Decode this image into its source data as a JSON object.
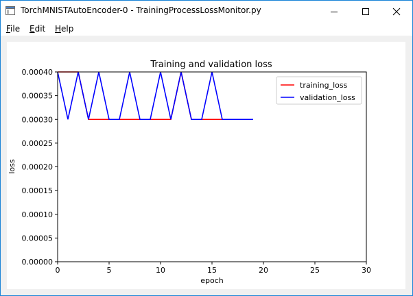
{
  "window": {
    "title": "TorchMNISTAutoEncoder-0 - TrainingProcessLossMonitor.py",
    "border_color": "#1883d7"
  },
  "titlebar": {
    "minimize_icon": "minimize-icon",
    "maximize_icon": "maximize-icon",
    "close_icon": "close-icon"
  },
  "menu": {
    "file": {
      "u": "F",
      "rest": "ile"
    },
    "edit": {
      "u": "E",
      "rest": "dit"
    },
    "help": {
      "u": "H",
      "rest": "elp"
    }
  },
  "chart_data": {
    "type": "line",
    "title": "Training and validation loss",
    "xlabel": "epoch",
    "ylabel": "loss",
    "xlim": [
      0,
      30
    ],
    "ylim": [
      0,
      0.0004
    ],
    "xticks": [
      "0",
      "5",
      "10",
      "15",
      "20",
      "25",
      "30"
    ],
    "yticks": [
      "0.00000",
      "0.00005",
      "0.00010",
      "0.00015",
      "0.00020",
      "0.00025",
      "0.00030",
      "0.00035",
      "0.00040"
    ],
    "grid": false,
    "legend_position": "top-right",
    "x": [
      0,
      1,
      2,
      3,
      4,
      5,
      6,
      7,
      8,
      9,
      10,
      11,
      12,
      13,
      14,
      15,
      16,
      17,
      18,
      19
    ],
    "series": [
      {
        "name": "training_loss",
        "color": "#ff0000",
        "values": [
          0.0004,
          0.0004,
          0.0004,
          0.0003,
          0.0003,
          0.0003,
          0.0003,
          0.0003,
          0.0003,
          0.0003,
          0.0003,
          0.0003,
          0.0004,
          0.0003,
          0.0003,
          0.0003,
          0.0003,
          0.0003,
          0.0003,
          0.0003
        ]
      },
      {
        "name": "validation_loss",
        "color": "#0000ff",
        "values": [
          0.0004,
          0.0003,
          0.0004,
          0.0003,
          0.0004,
          0.0003,
          0.0003,
          0.0004,
          0.0003,
          0.0003,
          0.0004,
          0.0003,
          0.0004,
          0.0003,
          0.0003,
          0.0004,
          0.0003,
          0.0003,
          0.0003,
          0.0003
        ]
      }
    ]
  }
}
